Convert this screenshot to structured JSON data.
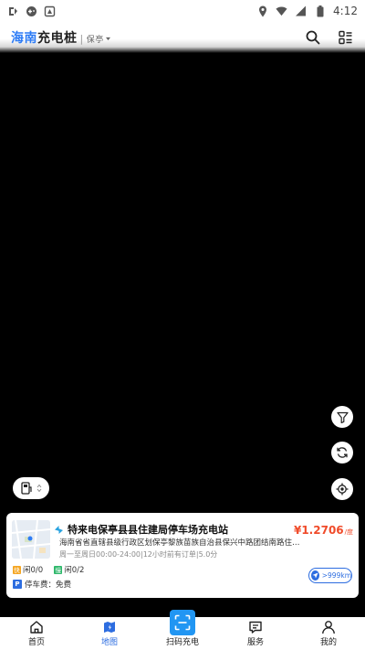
{
  "status_bar": {
    "time": "4:12"
  },
  "header": {
    "brand_highlight": "海南",
    "brand_rest": "充电桩",
    "location": "保亭"
  },
  "station": {
    "name": "特来电保亭县县住建局停车场充电站",
    "price": "¥1.2706",
    "price_unit": "/度",
    "address": "海南省省直辖县级行政区划保亭黎族苗族自治县保兴中路团结南路住房和城乡建设局",
    "hours": "周一至周日00:00-24:00|12小时前有订单|5.0分",
    "fast_tag": "快",
    "fast_label": "闲0/0",
    "slow_tag": "慢",
    "slow_label": "闲0/2",
    "park_tag": "P",
    "parking": "停车费：免费",
    "distance": ">999km"
  },
  "nav": {
    "home": "首页",
    "map": "地图",
    "scan": "扫码充电",
    "service": "服务",
    "mine": "我的"
  },
  "colors": {
    "accent": "#2d6de0",
    "brand": "#2d7cf6",
    "price": "#f04b2a",
    "fast": "#f5a623",
    "slow": "#2db76a",
    "scan": "#2196f3"
  }
}
